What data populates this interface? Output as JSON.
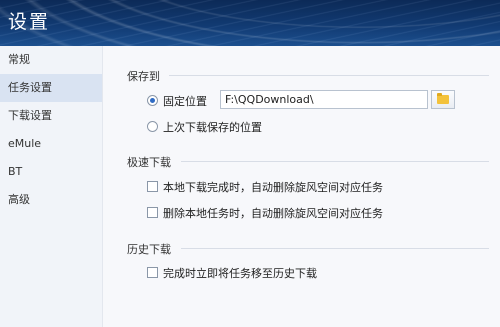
{
  "window": {
    "title": "设置"
  },
  "sidebar": {
    "items": [
      {
        "label": "常规"
      },
      {
        "label": "任务设置"
      },
      {
        "label": "下载设置"
      },
      {
        "label": "eMule"
      },
      {
        "label": "BT"
      },
      {
        "label": "高级"
      }
    ],
    "active_index": 1
  },
  "sections": {
    "save_to": {
      "title": "保存到",
      "fixed_location_label": "固定位置",
      "path_value": "F:\\QQDownload\\",
      "last_location_label": "上次下载保存的位置",
      "selected": "固定位置",
      "browse_icon": "folder-icon"
    },
    "turbo": {
      "title": "极速下载",
      "option1": "本地下载完成时，自动删除旋风空间对应任务",
      "option2": "删除本地任务时，自动删除旋风空间对应任务"
    },
    "history": {
      "title": "历史下载",
      "option1": "完成时立即将任务移至历史下载"
    }
  },
  "colors": {
    "accent": "#2f6bc4",
    "header": "#113a72",
    "active_nav": "#d9e3f2"
  }
}
